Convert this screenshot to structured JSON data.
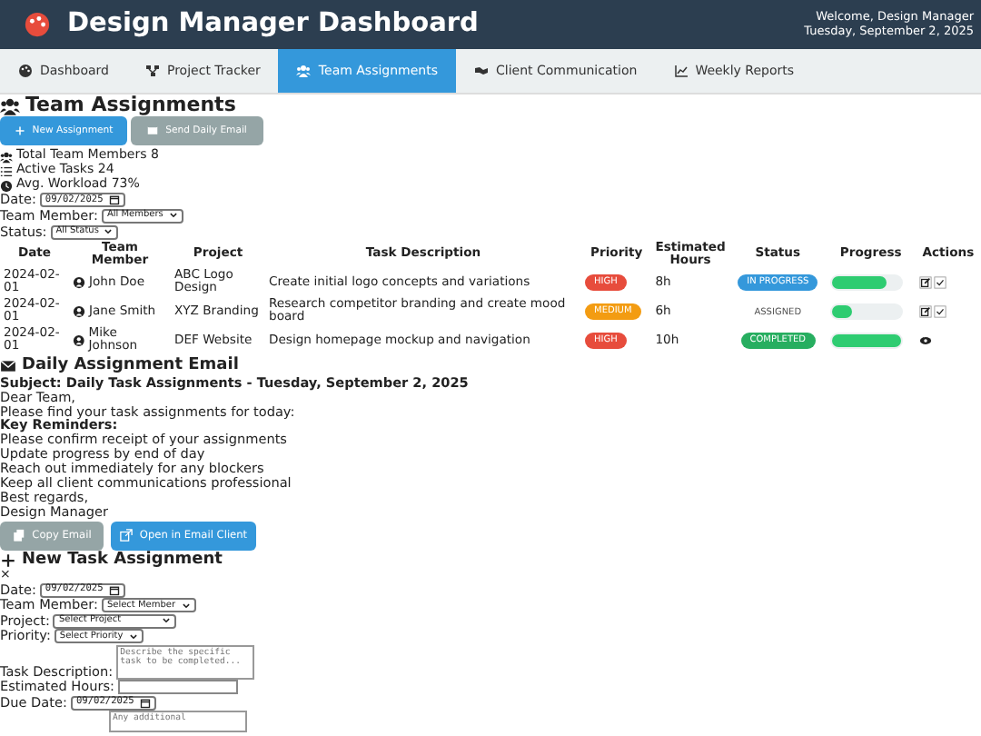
{
  "header": {
    "title": "Design Manager Dashboard",
    "welcome": "Welcome, Design Manager",
    "date": "Tuesday, September 2, 2025"
  },
  "tabs": [
    {
      "label": "Dashboard",
      "selected": false
    },
    {
      "label": "Project Tracker",
      "selected": false
    },
    {
      "label": "Team Assignments",
      "selected": true
    },
    {
      "label": "Client Communication",
      "selected": false
    },
    {
      "label": "Weekly Reports",
      "selected": false
    }
  ],
  "section_title": "Team Assignments",
  "buttons": [
    {
      "label": "New Assignment",
      "kind": "primary"
    },
    {
      "label": "Send Daily Email",
      "kind": "secondary"
    }
  ],
  "stats": [
    {
      "label": "Total Team Members",
      "value": "8"
    },
    {
      "label": "Active Tasks",
      "value": "24"
    },
    {
      "label": "Avg. Workload",
      "value": "73%"
    }
  ],
  "filters": [
    {
      "label": "Date:",
      "kind": "date",
      "value": "09/02/2025"
    },
    {
      "label": "Team Member:",
      "kind": "select",
      "value": "All Members"
    },
    {
      "label": "Status:",
      "kind": "select",
      "value": "All Status"
    }
  ],
  "table": {
    "columns": [
      "Date",
      "Team Member",
      "Project",
      "Task Description",
      "Priority",
      "Estimated Hours",
      "Status",
      "Progress",
      "Actions"
    ],
    "rows": [
      {
        "date": "2024-02-01",
        "member": "John Doe",
        "project": "ABC Logo Design",
        "task": "Create initial logo concepts and variations",
        "priority": {
          "text": "HIGH",
          "color": "#e74c3c"
        },
        "hours": "8h",
        "status": {
          "text": "IN PROGRESS",
          "kind": "progress"
        },
        "level": 0.8
      },
      {
        "date": "2024-02-01",
        "member": "Jane Smith",
        "project": "XYZ Branding",
        "task": "Research competitor branding and create mood board",
        "priority": {
          "text": "MEDIUM",
          "color": "#f39c12"
        },
        "hours": "6h",
        "status": {
          "text": "ASSIGNED",
          "kind": "assigned"
        },
        "level": 0.3
      },
      {
        "date": "2024-02-01",
        "member": "Mike Johnson",
        "project": "DEF Website",
        "task": "Design homepage mockup and navigation",
        "priority": {
          "text": "HIGH",
          "color": "#e74c3c"
        },
        "hours": "10h",
        "status": {
          "text": "COMPLETED",
          "kind": "completed"
        },
        "level": 1.0
      }
    ]
  },
  "email": {
    "title": "Daily Assignment Email",
    "subject": "Subject: Daily Task Assignments - Tuesday, September 2, 2025",
    "lines": [
      {
        "text": "Dear Team,",
        "kind": "plain"
      },
      {
        "text": "Please find your task assignments for today:",
        "kind": "plain"
      },
      {
        "text": "Key Reminders:",
        "kind": "bold"
      },
      {
        "text": "Please confirm receipt of your assignments",
        "kind": "plain"
      },
      {
        "text": "Update progress by end of day",
        "kind": "plain"
      },
      {
        "text": "Reach out immediately for any blockers",
        "kind": "plain"
      },
      {
        "text": "Keep all client communications professional",
        "kind": "plain"
      },
      {
        "text": "Best regards,",
        "kind": "plain"
      },
      {
        "text": "Design Manager",
        "kind": "plain"
      }
    ],
    "buttons": [
      {
        "label": "Copy Email",
        "kind": "secondary"
      },
      {
        "label": "Open in Email Client",
        "kind": "primary"
      }
    ]
  },
  "form": {
    "title": "New Task Assignment",
    "close": "×",
    "fields": [
      {
        "label": "Date:",
        "kind": "date",
        "value": "09/02/2025"
      },
      {
        "label": "Team Member:",
        "kind": "select",
        "value": "Select Member"
      },
      {
        "label": "Project:",
        "kind": "select",
        "value": "Select Project"
      },
      {
        "label": "Priority:",
        "kind": "select",
        "value": "Select Priority"
      },
      {
        "label": "Task Description:",
        "kind": "textarea",
        "placeholder": "Describe the specific task to be completed..."
      },
      {
        "label": "Estimated Hours:",
        "kind": "number"
      },
      {
        "label": "Due Date:",
        "kind": "date",
        "value": "09/02/2025"
      },
      {
        "kind": "textarea-cut",
        "placeholder": "Any additional"
      }
    ]
  }
}
